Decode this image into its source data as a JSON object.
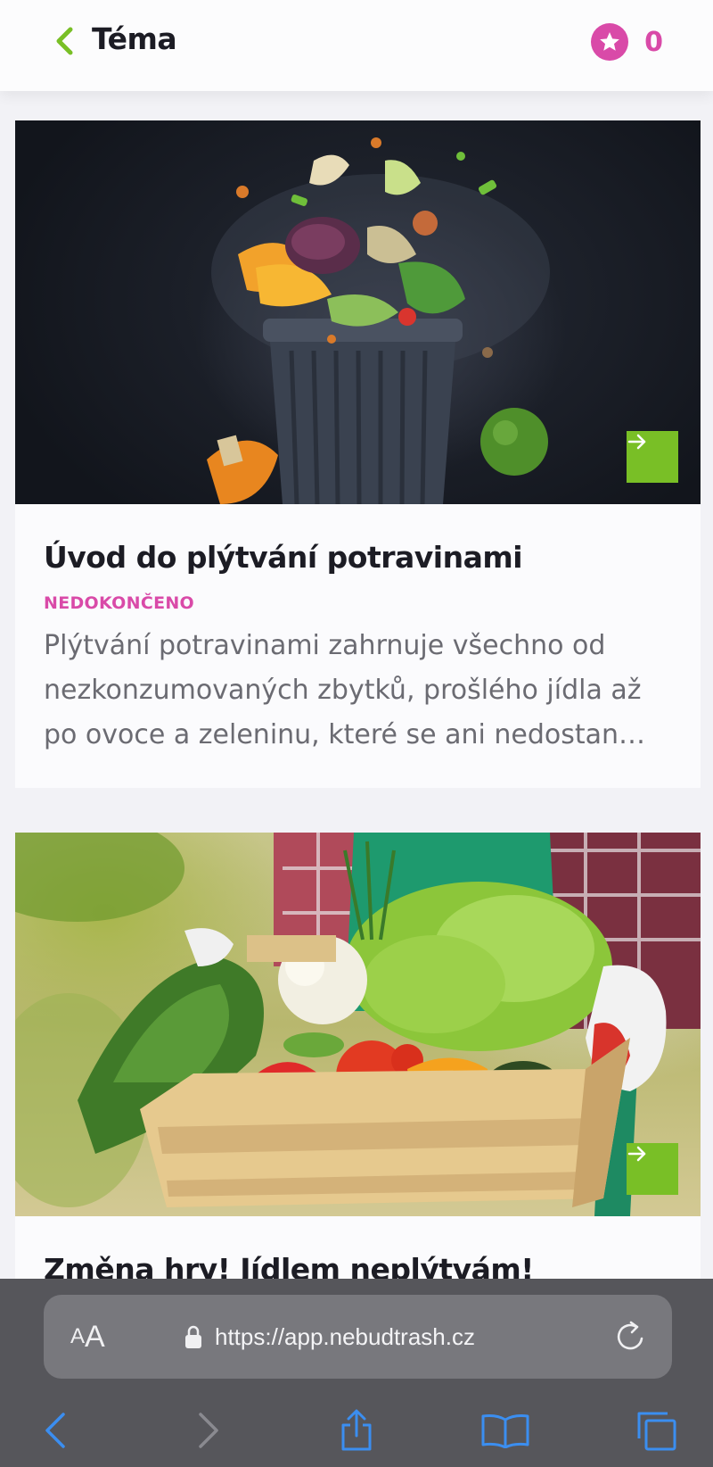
{
  "header": {
    "title": "Téma",
    "score": "0",
    "back_icon": "chevron-left-icon",
    "score_icon": "star-badge-icon"
  },
  "cards": [
    {
      "title": "Úvod do plýtvání potravinami",
      "status": "NEDOKONČENO",
      "description": "Plýtvání potravinami zahrnuje všechno od nezkonzumovaných zbytků, prošlého jídla až po ovoce a zeleninu, které se ani nedostan…",
      "image": "food-waste-bin-photo"
    },
    {
      "title": "Změna hry! Jídlem neplýtvám!",
      "image": "vegetable-crate-photo"
    }
  ],
  "browser": {
    "text_size_small": "A",
    "text_size_large": "A",
    "url": "https://app.nebudtrash.cz"
  },
  "colors": {
    "accent_green": "#79bf26",
    "accent_pink": "#d94aa8",
    "safari_blue": "#3b8ef0"
  }
}
